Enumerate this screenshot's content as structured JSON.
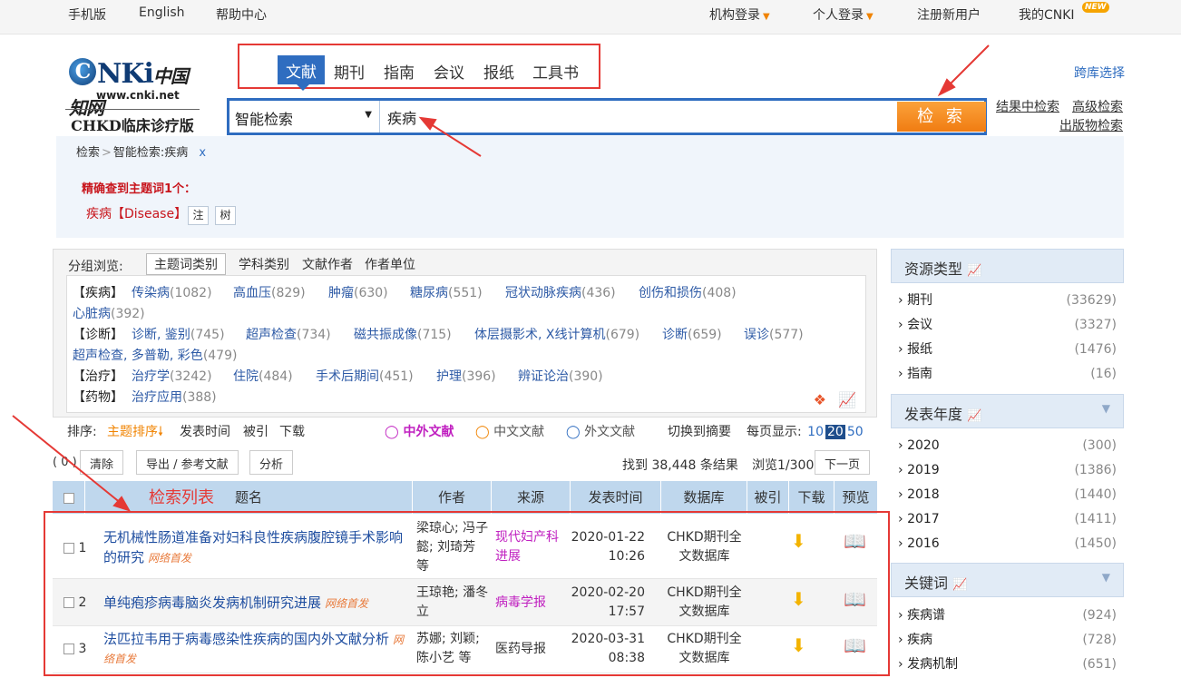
{
  "topbar": {
    "mobile": "手机版",
    "english": "English",
    "help": "帮助中心",
    "org_login": "机构登录",
    "personal_login": "个人登录",
    "register": "注册新用户",
    "my_cnki": "我的CNKI",
    "new_badge": "NEW"
  },
  "logo": {
    "url_text": "www.cnki.net",
    "cn_name": "中国知网",
    "subtitle": "CHKD临床诊疗版"
  },
  "tabs": [
    "文献",
    "期刊",
    "指南",
    "会议",
    "报纸",
    "工具书"
  ],
  "search": {
    "type": "智能检索",
    "query": "疾病",
    "button": "检 索"
  },
  "header_links": {
    "cross_db": "跨库选择",
    "search_in_results": "结果中检索",
    "advanced": "高级检索",
    "publication": "出版物检索"
  },
  "breadcrumb": {
    "home": "检索",
    "current": "智能检索:疾病",
    "close": "x"
  },
  "exact": {
    "title": "精确查到主题词1个：",
    "term": "疾病【Disease】",
    "note_btn": "注",
    "tree_btn": "树"
  },
  "group": {
    "label": "分组浏览:",
    "tabs": [
      "主题词类别",
      "学科类别",
      "文献作者",
      "作者单位"
    ],
    "lines": [
      {
        "label": "【疾病】",
        "items": [
          {
            "name": "传染病",
            "count": "(1082)"
          },
          {
            "name": "高血压",
            "count": "(829)"
          },
          {
            "name": "肿瘤",
            "count": "(630)"
          },
          {
            "name": "糖尿病",
            "count": "(551)"
          },
          {
            "name": "冠状动脉疾病",
            "count": "(436)"
          },
          {
            "name": "创伤和损伤",
            "count": "(408)"
          }
        ]
      },
      {
        "label": "",
        "items": [
          {
            "name": "心脏病",
            "count": "(392)"
          }
        ]
      },
      {
        "label": "【诊断】",
        "items": [
          {
            "name": "诊断, 鉴别",
            "count": "(745)"
          },
          {
            "name": "超声检查",
            "count": "(734)"
          },
          {
            "name": "磁共振成像",
            "count": "(715)"
          },
          {
            "name": "体层摄影术, X线计算机",
            "count": "(679)"
          },
          {
            "name": "诊断",
            "count": "(659)"
          },
          {
            "name": "误诊",
            "count": "(577)"
          }
        ]
      },
      {
        "label": "",
        "items": [
          {
            "name": "超声检查, 多普勒, 彩色",
            "count": "(479)"
          }
        ]
      },
      {
        "label": "【治疗】",
        "items": [
          {
            "name": "治疗学",
            "count": "(3242)"
          },
          {
            "name": "住院",
            "count": "(484)"
          },
          {
            "name": "手术后期间",
            "count": "(451)"
          },
          {
            "name": "护理",
            "count": "(396)"
          },
          {
            "name": "辨证论治",
            "count": "(390)"
          }
        ]
      },
      {
        "label": "【药物】",
        "items": [
          {
            "name": "治疗应用",
            "count": "(388)"
          }
        ]
      }
    ]
  },
  "sort": {
    "label": "排序:",
    "options": [
      "主题排序",
      "发表时间",
      "被引",
      "下载"
    ],
    "lang_all": "中外文献",
    "lang_cn": "中文文献",
    "lang_en": "外文文献",
    "switch": "切换到摘要",
    "per_page_label": "每页显示:",
    "per_page": [
      "10",
      "20",
      "50"
    ],
    "per_page_selected": "20"
  },
  "actions": {
    "selected": "( 0 )",
    "clear": "清除",
    "export": "导出 / 参考文献",
    "analyze": "分析",
    "found_prefix": "找到",
    "found_count": "38,448",
    "found_suffix": "条结果",
    "page": "浏览1/300",
    "next": "下一页"
  },
  "table": {
    "headers": [
      "题名",
      "作者",
      "来源",
      "发表时间",
      "数据库",
      "被引",
      "下载",
      "预览"
    ],
    "rows": [
      {
        "num": "1",
        "title": "无机械性肠道准备对妇科良性疾病腹腔镜手术影响的研究",
        "tag": "网络首发",
        "authors": "梁琼心; 冯子懿; 刘琦芳 等",
        "source": "现代妇产科进展",
        "date": "2020-01-22",
        "time": "10:26",
        "db": "CHKD期刊全文数据库"
      },
      {
        "num": "2",
        "title": "单纯疱疹病毒脑炎发病机制研究进展",
        "tag": "网络首发",
        "authors": "王琼艳; 潘冬立",
        "source": "病毒学报",
        "date": "2020-02-20",
        "time": "17:57",
        "db": "CHKD期刊全文数据库"
      },
      {
        "num": "3",
        "title": "法匹拉韦用于病毒感染性疾病的国内外文献分析",
        "tag": "网络首发",
        "authors": "苏娜; 刘颖; 陈小艺 等",
        "source": "医药导报",
        "date": "2020-03-31",
        "time": "08:38",
        "db": "CHKD期刊全文数据库"
      }
    ]
  },
  "annotation": {
    "list_label": "检索列表"
  },
  "sidebar": {
    "resource": {
      "title": "资源类型",
      "items": [
        {
          "name": "期刊",
          "count": "(33629)"
        },
        {
          "name": "会议",
          "count": "(3327)"
        },
        {
          "name": "报纸",
          "count": "(1476)"
        },
        {
          "name": "指南",
          "count": "(16)"
        }
      ]
    },
    "year": {
      "title": "发表年度",
      "items": [
        {
          "name": "2020",
          "count": "(300)"
        },
        {
          "name": "2019",
          "count": "(1386)"
        },
        {
          "name": "2018",
          "count": "(1440)"
        },
        {
          "name": "2017",
          "count": "(1411)"
        },
        {
          "name": "2016",
          "count": "(1450)"
        }
      ]
    },
    "keyword": {
      "title": "关键词",
      "items": [
        {
          "name": "疾病谱",
          "count": "(924)"
        },
        {
          "name": "疾病",
          "count": "(728)"
        },
        {
          "name": "发病机制",
          "count": "(651)"
        }
      ]
    }
  },
  "colors": {
    "accent": "#2f6dc0",
    "search_btn": "#f07c12",
    "annotation": "#e53935",
    "disease_red": "#c8161d"
  }
}
